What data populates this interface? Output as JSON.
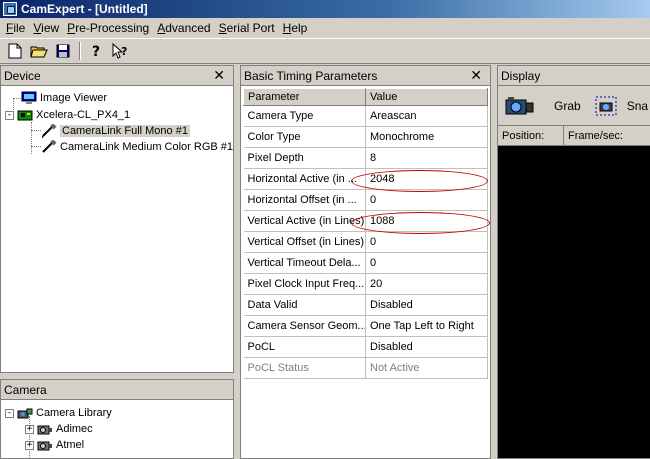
{
  "window": {
    "title": "CamExpert - [Untitled]"
  },
  "menu": [
    {
      "label": "File",
      "u": "F",
      "rest": "ile"
    },
    {
      "label": "View",
      "u": "V",
      "rest": "iew"
    },
    {
      "label": "Pre-Processing",
      "u": "P",
      "rest": "re-Processing"
    },
    {
      "label": "Advanced",
      "u": "A",
      "rest": "dvanced"
    },
    {
      "label": "Serial Port",
      "u": "S",
      "rest": "erial Port"
    },
    {
      "label": "Help",
      "u": "H",
      "rest": "elp"
    }
  ],
  "device_panel": {
    "title": "Device",
    "tree": [
      {
        "label": "Image Viewer",
        "icon": "monitor-icon"
      },
      {
        "label": "Xcelera-CL_PX4_1",
        "icon": "board-icon"
      },
      {
        "label": "CameraLink Full Mono #1",
        "icon": "cable-icon",
        "selected": true
      },
      {
        "label": "CameraLink Medium Color RGB #1",
        "icon": "cable-icon"
      }
    ]
  },
  "camera_panel": {
    "title": "Camera",
    "tree": [
      {
        "label": "Camera Library",
        "icon": "camera-library-icon",
        "expander": "-"
      },
      {
        "label": "Adimec",
        "icon": "camera-folder-icon",
        "expander": "+"
      },
      {
        "label": "Atmel",
        "icon": "camera-folder-icon",
        "expander": "+"
      }
    ]
  },
  "params_panel": {
    "title": "Basic Timing Parameters",
    "columns": [
      "Parameter",
      "Value"
    ],
    "rows": [
      {
        "param": "Camera Type",
        "value": "Areascan"
      },
      {
        "param": "Color Type",
        "value": "Monochrome"
      },
      {
        "param": "Pixel Depth",
        "value": "8"
      },
      {
        "param": "Horizontal Active (in ...",
        "value": "2048",
        "highlight": true
      },
      {
        "param": "Horizontal Offset (in ...",
        "value": "0"
      },
      {
        "param": "Vertical Active (in Lines)",
        "value": "1088",
        "highlight": true
      },
      {
        "param": "Vertical Offset (in Lines)",
        "value": "0"
      },
      {
        "param": "Vertical Timeout Dela...",
        "value": "0"
      },
      {
        "param": "Pixel Clock Input Freq...",
        "value": "20"
      },
      {
        "param": "Data Valid",
        "value": "Disabled"
      },
      {
        "param": "Camera Sensor Geom...",
        "value": "One Tap Left to Right"
      },
      {
        "param": "PoCL",
        "value": "Disabled"
      },
      {
        "param": "PoCL Status",
        "value": "Not Active",
        "disabled": true
      }
    ]
  },
  "display_panel": {
    "title": "Display",
    "grab_label": "Grab",
    "snap_label": "Sna",
    "position_label": "Position:",
    "fps_label": "Frame/sec:"
  },
  "colors": {
    "highlight_ellipse": "#c00000",
    "titlebar": "#0a246a",
    "display_bg": "#000000"
  }
}
